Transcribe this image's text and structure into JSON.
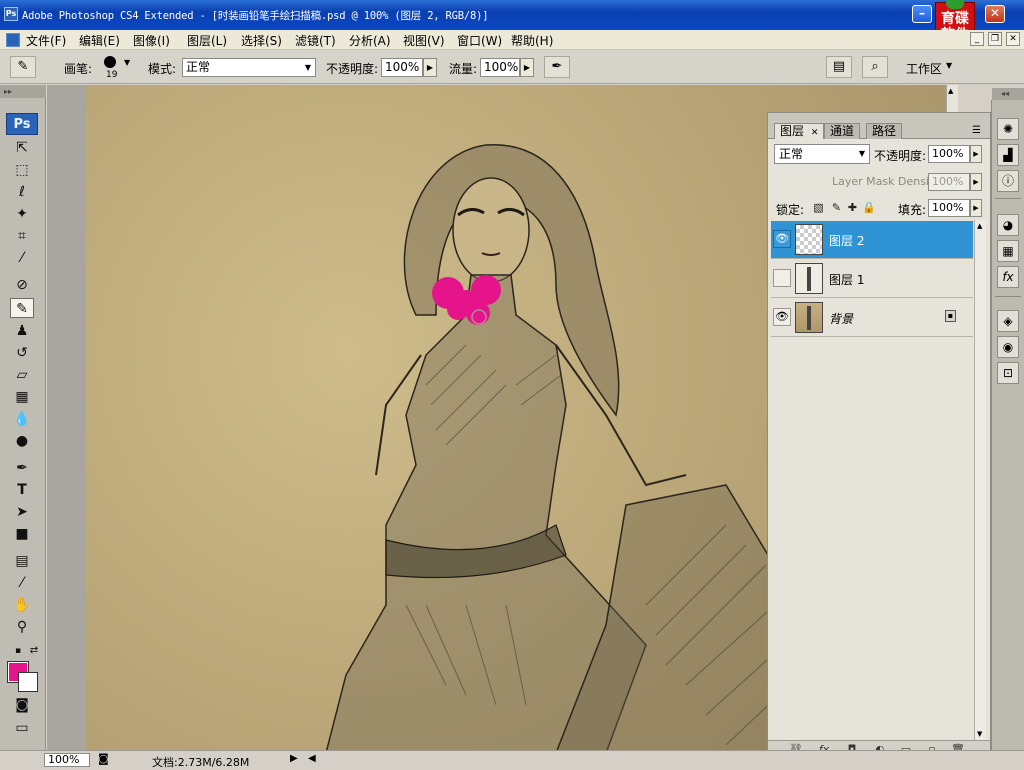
{
  "window": {
    "title": "Adobe Photoshop CS4 Extended - [时装画铅笔手绘扫描稿.psd @ 100% (图层 2, RGB/8)]",
    "brand_logo_text": [
      "育碟",
      "软件"
    ]
  },
  "menu": {
    "items": [
      "文件(F)",
      "编辑(E)",
      "图像(I)",
      "图层(L)",
      "选择(S)",
      "滤镜(T)",
      "分析(A)",
      "视图(V)",
      "窗口(W)",
      "帮助(H)"
    ]
  },
  "options": {
    "brush_label": "画笔:",
    "brush_size": "19",
    "mode_label": "模式:",
    "mode_value": "正常",
    "opacity_label": "不透明度:",
    "opacity_value": "100%",
    "flow_label": "流量:",
    "flow_value": "100%",
    "workspace_label": "工作区"
  },
  "tools": {
    "badge": "Ps",
    "icons": [
      "move-icon",
      "marquee-icon",
      "lasso-icon",
      "magic-wand-icon",
      "crop-icon",
      "eyedropper-icon",
      "healing-brush-icon",
      "brush-icon",
      "clone-stamp-icon",
      "history-brush-icon",
      "eraser-icon",
      "gradient-icon",
      "blur-icon",
      "dodge-icon",
      "pen-icon",
      "type-icon",
      "path-selection-icon",
      "rectangle-icon",
      "notes-icon",
      "eyedropper2-icon",
      "hand-icon",
      "zoom-icon"
    ],
    "foreground_color": "#e5148a",
    "background_color": "#ffffff"
  },
  "status": {
    "zoom": "100%",
    "doc_info": "文档:2.73M/6.28M"
  },
  "layers_panel": {
    "tabs": [
      "图层",
      "通道",
      "路径"
    ],
    "blend_mode": "正常",
    "opacity_label": "不透明度:",
    "opacity_value": "100%",
    "mask_density_label": "Layer Mask Density",
    "mask_density_value": "100%",
    "lock_label": "锁定:",
    "fill_label": "填充:",
    "fill_value": "100%",
    "layers": [
      {
        "name": "图层 2",
        "visible": true,
        "selected": true
      },
      {
        "name": "图层 1",
        "visible": false,
        "selected": false
      },
      {
        "name": "背景",
        "visible": true,
        "selected": false,
        "locked": true
      }
    ]
  },
  "accent_color": "#2f93d4"
}
